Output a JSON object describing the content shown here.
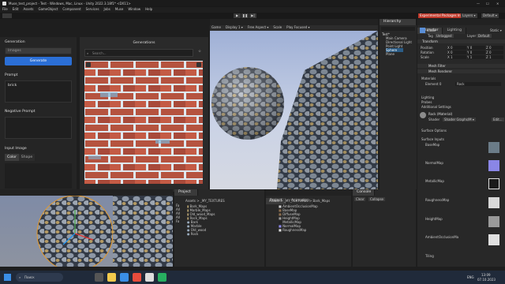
{
  "titlebar": {
    "title": "Muse_test_project - Test - Windows, Mac, Linux - Unity 2022.3.18f1* <DX11>"
  },
  "menu": [
    "File",
    "Edit",
    "Assets",
    "GameObject",
    "Component",
    "Services",
    "Jobs",
    "Muse",
    "Window",
    "Help"
  ],
  "toolbar": {
    "experimental": "Experimental Packages In Use ▾",
    "layers": "Layers ▾",
    "layout": "Default ▾"
  },
  "muse": {
    "generation_label": "Generation",
    "mode_value": "Images",
    "generate_label": "Generate",
    "prompt_label": "Prompt",
    "prompt_value": "brick",
    "negative_label": "Negative Prompt",
    "input_image_label": "Input Image",
    "input_tabs": [
      "Color",
      "Shape"
    ],
    "generations_title": "Generations",
    "search_placeholder": "Search..."
  },
  "scene_tabs": [
    "Scene",
    "Game",
    "Preferences",
    "Project Settings",
    "Animator"
  ],
  "game_toolbar": {
    "game": "Game",
    "display": "Display 1 ▾",
    "aspect": "Free Aspect ▾",
    "scale": "Scale",
    "play_focused": "Play Focused ▾"
  },
  "hierarchy": {
    "tab": "Hierarchy",
    "items": [
      "Test*",
      "Main Camera",
      "Directional Light",
      "Point Light",
      "Sphere",
      "Plane"
    ]
  },
  "inspector": {
    "tabs": [
      "Inspector",
      "Lighting"
    ],
    "object_name": "Cube",
    "static_label": "Static ▾",
    "tag_label": "Tag",
    "tag_value": "Untagged",
    "layer_label": "Layer",
    "layer_value": "Default",
    "transform_label": "Transform",
    "transform_rows": [
      {
        "label": "Position",
        "x": "X 0",
        "y": "Y 0",
        "z": "Z 0"
      },
      {
        "label": "Rotation",
        "x": "X 0",
        "y": "Y 0",
        "z": "Z 0"
      },
      {
        "label": "Scale",
        "x": "X 1",
        "y": "Y 1",
        "z": "Z 1"
      }
    ],
    "components": [
      "Mesh Filter",
      "Mesh Renderer"
    ],
    "materials_label": "Materials",
    "element_label": "Element 0",
    "element_value": "Rock",
    "lighting_label": "Lighting",
    "probes_label": "Probes",
    "additional_label": "Additional Settings",
    "material_name": "Rock (Material)",
    "shader_label": "Shader",
    "shader_value": "Shader Graphs/M ▾",
    "edit_label": "Edit...",
    "surface_options": "Surface Options",
    "surface_inputs": "Surface Inputs",
    "maps": [
      "BaseMap",
      "NormalMap",
      "MetallicMap",
      "RoughnessMap",
      "HeightMap",
      "AmbientOcclusionMa"
    ],
    "tiling_label": "Tiling"
  },
  "bottom_left_tabs": [
    "Scene",
    "Project"
  ],
  "project": {
    "tab": "Project",
    "path": "Assets > _MY_TEXTURES",
    "folders": [
      "Bark_Maps",
      "Marble_Maps",
      "Old_wood_Maps",
      "Rock_Maps",
      "Bark",
      "Marble",
      "Old_wood",
      "Rock"
    ],
    "tree": [
      "Fa",
      "All",
      "All",
      "All",
      "Fa"
    ]
  },
  "project2": {
    "tabs": [
      "Project",
      "Animation"
    ],
    "path": "Assets > _MY_TEXTURES > Bark_Maps",
    "files": [
      "AmbientOcclusionMap",
      "BaseMap",
      "DiffuseMap",
      "HeightMap",
      "MetallicMap",
      "NormalMap",
      "RoughnessMap"
    ]
  },
  "console": {
    "tab": "Console",
    "clear": "Clear",
    "collapse": "Collapse"
  },
  "taskbar": {
    "search": "Поиск",
    "lang": "ENG",
    "time": "13:09",
    "date": "07.10.2023"
  },
  "colors": {
    "accent": "#2b6fd6",
    "bg": "#1e1e1e",
    "panel": "#282828",
    "sky": "#aab7d8"
  }
}
